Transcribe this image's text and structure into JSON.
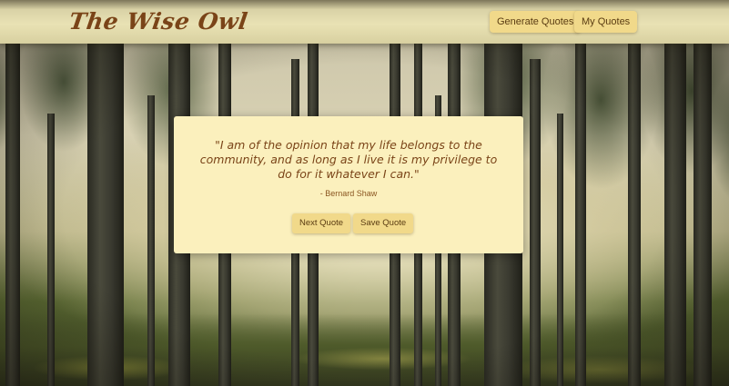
{
  "header": {
    "brand": "The Wise Owl",
    "nav": {
      "generate_label": "Generate Quotes",
      "my_quotes_label": "My Quotes"
    }
  },
  "quote_card": {
    "text": "\"I am of the opinion that my life belongs to the community, and as long as I live it is my privilege to do for it whatever I can.\"",
    "author": "- Bernard Shaw",
    "next_label": "Next Quote",
    "save_label": "Save Quote"
  },
  "theme": {
    "accent": "#f1d98a",
    "card_background": "#fbf0bd",
    "text_brown": "#7a4418"
  }
}
